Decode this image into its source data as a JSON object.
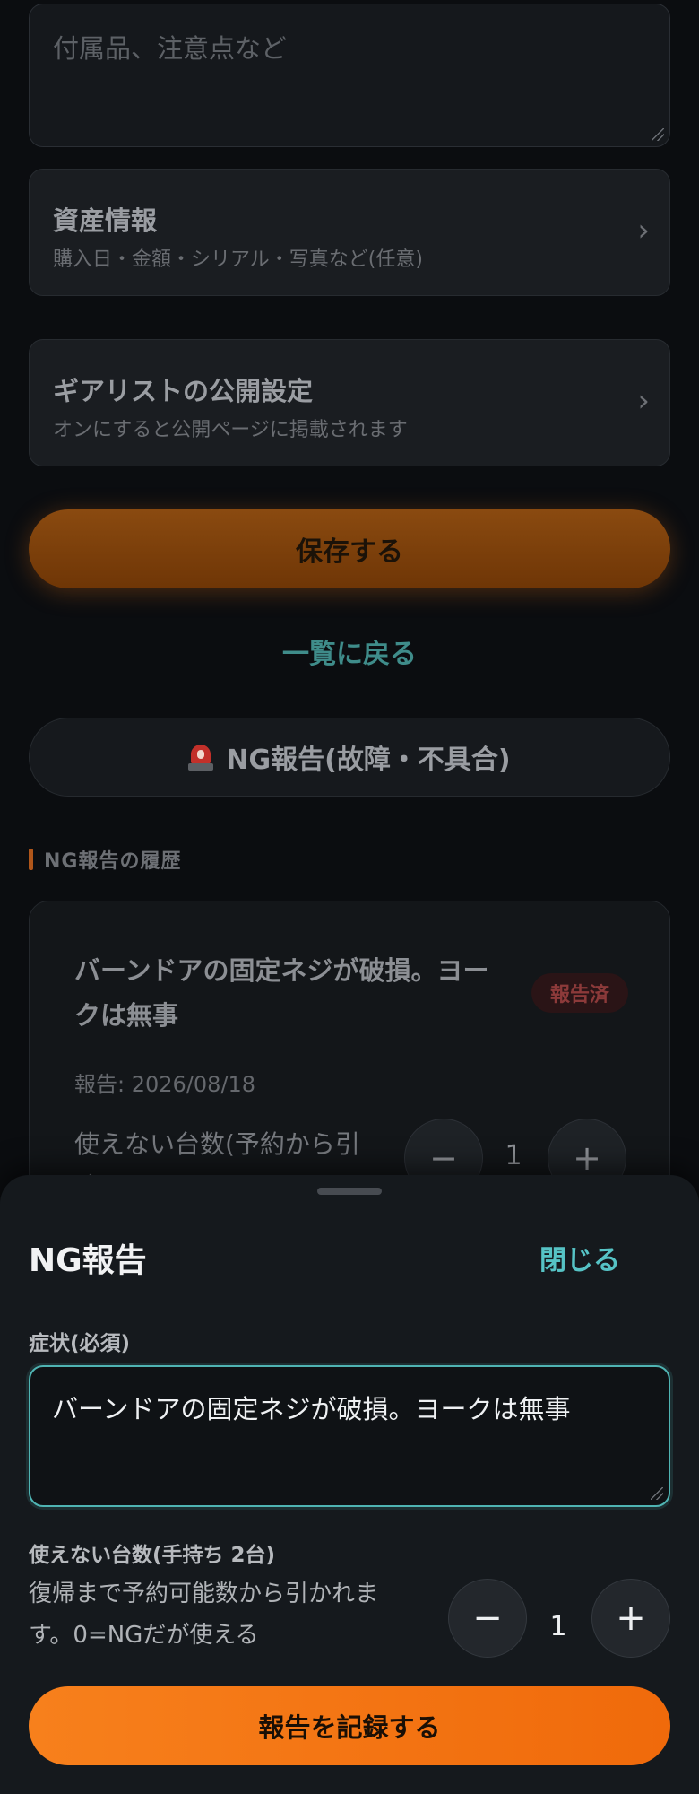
{
  "form": {
    "notes_placeholder": "付属品、注意点など",
    "asset_title": "資産情報",
    "asset_sub": "購入日・金額・シリアル・写真など(任意)",
    "public_title": "ギアリストの公開設定",
    "public_sub": "オンにすると公開ページに掲載されます",
    "save_label": "保存する",
    "back_label": "一覧に戻る",
    "ng_button_label": "NG報告(故障・不具合)"
  },
  "history": {
    "heading": "NG報告の履歴",
    "items": [
      {
        "text": "バーンドアの固定ネジが破損。ヨークは無事",
        "status": "報告済",
        "date": "報告: 2026/08/18",
        "unusable_label": "使えない台数(予約から引く)",
        "count": "1"
      }
    ]
  },
  "sheet": {
    "title": "NG報告",
    "close_label": "閉じる",
    "symptom_label": "症状(必須)",
    "symptom_value": "バーンドアの固定ネジが破損。ヨークは無事",
    "unusable_label": "使えない台数(手持ち 2台)",
    "help_text": "復帰まで予約可能数から引かれます。0=NGだが使える",
    "count": "1",
    "minus": "−",
    "plus": "+",
    "record_label": "報告を記録する"
  },
  "icons": {
    "chevron": "›",
    "siren": "siren-icon"
  },
  "colors": {
    "accent_orange": "#f7801c",
    "accent_teal": "#56c3c5",
    "background": "#0b0d10"
  }
}
